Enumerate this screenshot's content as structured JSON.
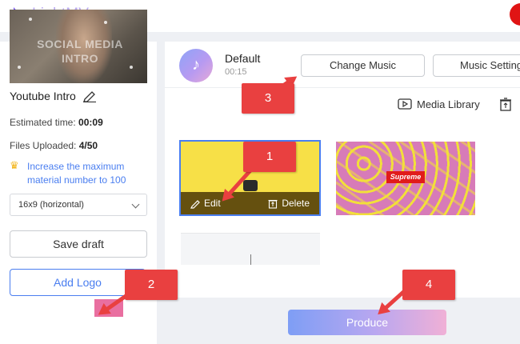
{
  "app": {
    "name": "LightMV"
  },
  "project": {
    "title": "Youtube Intro",
    "thumbnail_text": "SOCIAL MEDIA INTRO",
    "estimated_label": "Estimated time:",
    "estimated_value": "00:09",
    "files_label": "Files Uploaded:",
    "files_value": "4/50",
    "upgrade_text": "Increase the maximum material number to 100",
    "ratio": "16x9 (horizontal)"
  },
  "buttons": {
    "save_draft": "Save draft",
    "add_logo": "Add Logo",
    "change_music": "Change Music",
    "music_settings": "Music Settings",
    "media_library": "Media Library",
    "produce": "Produce",
    "edit": "Edit",
    "delete": "Delete"
  },
  "music": {
    "name": "Default",
    "duration": "00:15"
  },
  "scenes": [
    {
      "label": ""
    },
    {
      "label": "Supreme"
    },
    {
      "label": ""
    }
  ],
  "annotations": [
    "1",
    "2",
    "3",
    "4"
  ],
  "colors": {
    "accent": "#4a7ef0",
    "annotation": "#e94040",
    "scene_yellow": "#f7e047",
    "scene_pink": "#d77bb8"
  }
}
